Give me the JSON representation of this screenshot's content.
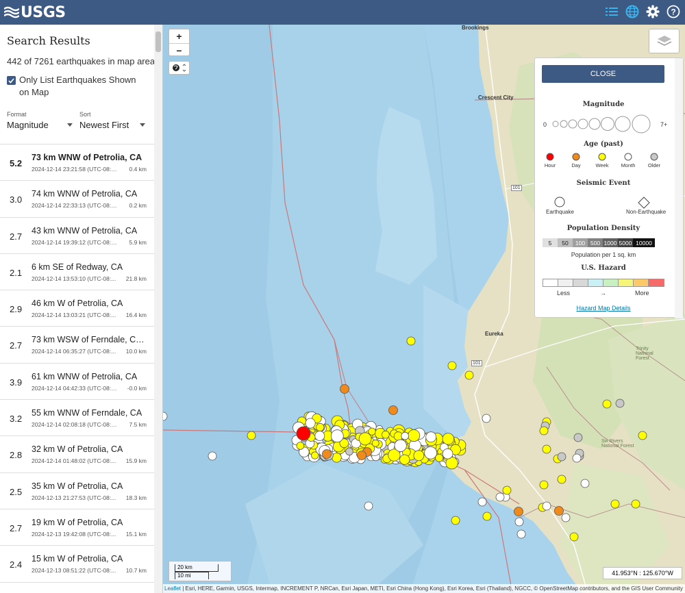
{
  "header": {
    "logo_text": "USGS",
    "bg": "#3c5a84"
  },
  "sidebar": {
    "title": "Search Results",
    "count": "442 of 7261 earthquakes in map area.",
    "only_list_label": "Only List Earthquakes Shown on Map",
    "format_label": "Format",
    "format_value": "Magnitude",
    "sort_label": "Sort",
    "sort_value": "Newest First"
  },
  "earthquakes": [
    {
      "mag": "5.2",
      "place": "73 km WNW of Petrolia, CA",
      "time": "2024-12-14 23:21:58 (UTC-08:00)",
      "depth": "0.4 km"
    },
    {
      "mag": "3.0",
      "place": "74 km WNW of Petrolia, CA",
      "time": "2024-12-14 22:33:13 (UTC-08:00)",
      "depth": "0.2 km"
    },
    {
      "mag": "2.7",
      "place": "43 km WNW of Petrolia, CA",
      "time": "2024-12-14 19:39:12 (UTC-08:00)",
      "depth": "5.9 km"
    },
    {
      "mag": "2.1",
      "place": "6 km SE of Redway, CA",
      "time": "2024-12-14 13:53:10 (UTC-08:...",
      "depth": "21.8 km"
    },
    {
      "mag": "2.9",
      "place": "46 km W of Petrolia, CA",
      "time": "2024-12-14 13:03:21 (UTC-08:...",
      "depth": "16.4 km"
    },
    {
      "mag": "2.7",
      "place": "73 km WSW of Ferndale, Calif...",
      "time": "2024-12-14 06:35:27 (UTC-08:...",
      "depth": "10.0 km"
    },
    {
      "mag": "3.9",
      "place": "61 km WNW of Petrolia, CA",
      "time": "2024-12-14 04:42:33 (UTC-08:0...",
      "depth": "-0.0 km"
    },
    {
      "mag": "3.2",
      "place": "55 km WNW of Ferndale, CA",
      "time": "2024-12-14 02:08:18 (UTC-08:00)",
      "depth": "7.5 km"
    },
    {
      "mag": "2.8",
      "place": "32 km W of Petrolia, CA",
      "time": "2024-12-14 01:48:02 (UTC-08:...",
      "depth": "15.9 km"
    },
    {
      "mag": "2.5",
      "place": "35 km W of Petrolia, CA",
      "time": "2024-12-13 21:27:53 (UTC-08:...",
      "depth": "18.3 km"
    },
    {
      "mag": "2.7",
      "place": "19 km W of Petrolia, CA",
      "time": "2024-12-13 19:42:08 (UTC-08:...",
      "depth": "15.1 km"
    },
    {
      "mag": "2.4",
      "place": "15 km W of Petrolia, CA",
      "time": "2024-12-13 08:51:22 (UTC-08:...",
      "depth": "10.7 km"
    }
  ],
  "map": {
    "zoom_in": "+",
    "zoom_out": "−",
    "towns": {
      "brookings": "Brookings",
      "crescent_city": "Crescent City",
      "eureka": "Eureka",
      "trinity": "Trinity National Forest",
      "six_rivers": "Six Rivers National Forest",
      "hwy101a": "101",
      "hwy101b": "101"
    },
    "scale_km": "20 km",
    "scale_mi": "10 mi",
    "coords": "41.953°N : 125.670°W",
    "attrib_leaflet": "Leaflet",
    "attrib_rest": " | Esri, HERE, Garmin, USGS, Intermap, INCREMENT P, NRCan, Esri Japan, METI, Esri China (Hong Kong), Esri Korea, Esri (Thailand), NGCC, © OpenStreetMap contributors, and the GIS User Community"
  },
  "legend": {
    "close": "CLOSE",
    "magnitude_title": "Magnitude",
    "mag_min": "0",
    "mag_max": "7+",
    "age_title": "Age (past)",
    "ages": [
      "Hour",
      "Day",
      "Week",
      "Month",
      "Older"
    ],
    "age_colors": [
      "#ff0000",
      "#f08a1a",
      "#ffff00",
      "#ffffff",
      "#c8c8c8"
    ],
    "event_title": "Seismic Event",
    "event_eq": "Earthquake",
    "event_non": "Non-Earthquake",
    "pop_title": "Population Density",
    "pop_values": [
      "5",
      "50",
      "100",
      "500",
      "1000",
      "5000",
      "10000"
    ],
    "pop_unit": "Population per 1 sq. km",
    "hazard_title": "U.S. Hazard",
    "hazard_less": "Less",
    "hazard_arrow": "→",
    "hazard_more": "More",
    "hazard_link": "Hazard Map Details"
  }
}
